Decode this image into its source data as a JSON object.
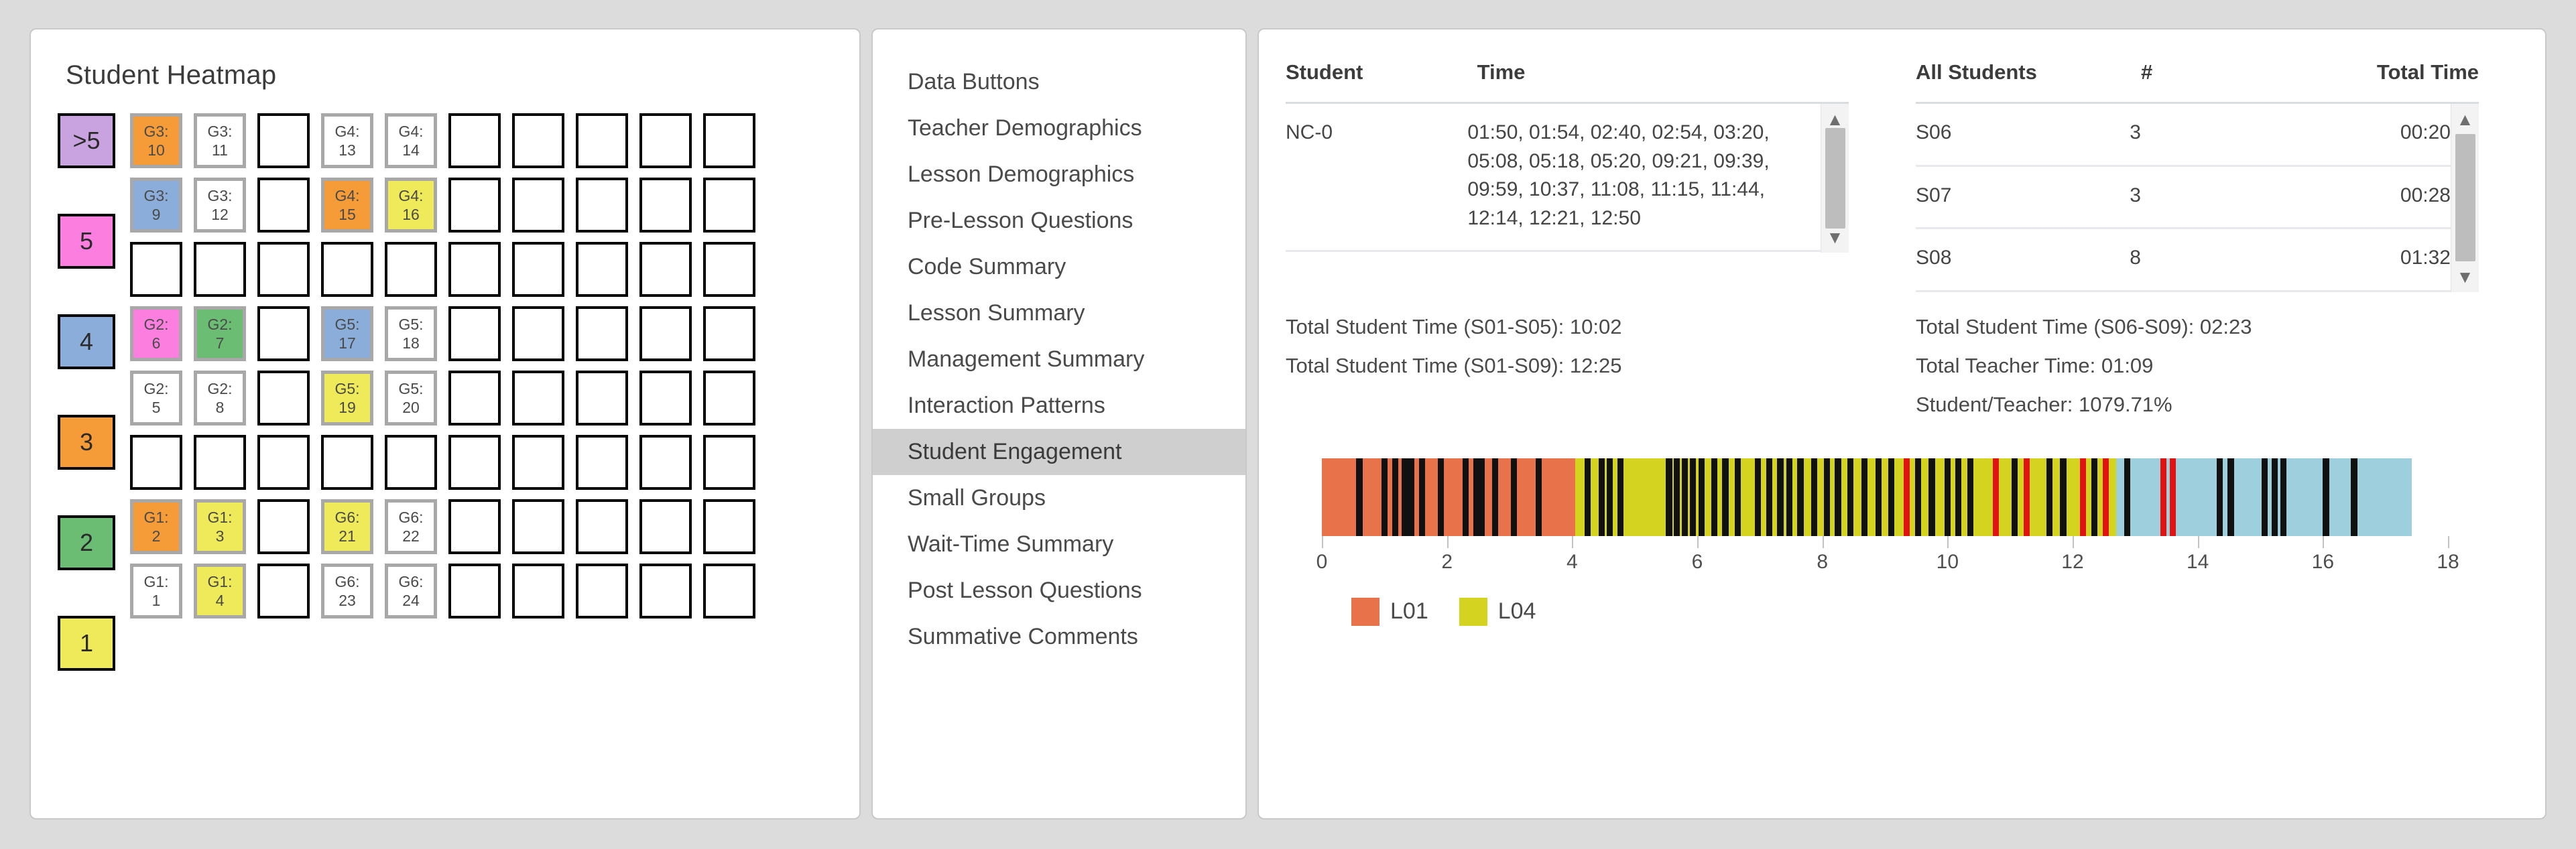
{
  "heatmap": {
    "title": "Student Heatmap",
    "legend": [
      {
        "label": ">5",
        "color": "#c9a3e0"
      },
      {
        "label": "5",
        "color": "#fc7fe0"
      },
      {
        "label": "4",
        "color": "#8badd9"
      },
      {
        "label": "3",
        "color": "#f59b38"
      },
      {
        "label": "2",
        "color": "#6cbd74"
      },
      {
        "label": "1",
        "color": "#eeea5a"
      }
    ],
    "columns": 10,
    "rows": [
      {
        "legend": ">5",
        "cells": [
          {
            "top": "G3:",
            "bottom": "10",
            "color": "#f59b38",
            "filled": true
          },
          {
            "top": "G3:",
            "bottom": "11",
            "color": "#ffffff",
            "filled": true
          },
          {
            "top": "",
            "bottom": "",
            "color": "#ffffff",
            "filled": false
          },
          {
            "top": "G4:",
            "bottom": "13",
            "color": "#ffffff",
            "filled": true
          },
          {
            "top": "G4:",
            "bottom": "14",
            "color": "#ffffff",
            "filled": true
          },
          {
            "top": "",
            "bottom": "",
            "color": "#ffffff",
            "filled": false
          },
          {
            "top": "",
            "bottom": "",
            "color": "#ffffff",
            "filled": false
          },
          {
            "top": "",
            "bottom": "",
            "color": "#ffffff",
            "filled": false
          },
          {
            "top": "",
            "bottom": "",
            "color": "#ffffff",
            "filled": false
          },
          {
            "top": "",
            "bottom": "",
            "color": "#ffffff",
            "filled": false
          }
        ]
      },
      {
        "legend": "5",
        "cells": [
          {
            "top": "G3:",
            "bottom": "9",
            "color": "#8badd9",
            "filled": true
          },
          {
            "top": "G3:",
            "bottom": "12",
            "color": "#ffffff",
            "filled": true
          },
          {
            "top": "",
            "bottom": "",
            "color": "#ffffff",
            "filled": false
          },
          {
            "top": "G4:",
            "bottom": "15",
            "color": "#f59b38",
            "filled": true
          },
          {
            "top": "G4:",
            "bottom": "16",
            "color": "#eeea5a",
            "filled": true
          },
          {
            "top": "",
            "bottom": "",
            "color": "#ffffff",
            "filled": false
          },
          {
            "top": "",
            "bottom": "",
            "color": "#ffffff",
            "filled": false
          },
          {
            "top": "",
            "bottom": "",
            "color": "#ffffff",
            "filled": false
          },
          {
            "top": "",
            "bottom": "",
            "color": "#ffffff",
            "filled": false
          },
          {
            "top": "",
            "bottom": "",
            "color": "#ffffff",
            "filled": false
          }
        ]
      },
      {
        "legend": "",
        "cells": [
          {
            "top": "",
            "bottom": "",
            "color": "#ffffff",
            "filled": false
          },
          {
            "top": "",
            "bottom": "",
            "color": "#ffffff",
            "filled": false
          },
          {
            "top": "",
            "bottom": "",
            "color": "#ffffff",
            "filled": false
          },
          {
            "top": "",
            "bottom": "",
            "color": "#ffffff",
            "filled": false
          },
          {
            "top": "",
            "bottom": "",
            "color": "#ffffff",
            "filled": false
          },
          {
            "top": "",
            "bottom": "",
            "color": "#ffffff",
            "filled": false
          },
          {
            "top": "",
            "bottom": "",
            "color": "#ffffff",
            "filled": false
          },
          {
            "top": "",
            "bottom": "",
            "color": "#ffffff",
            "filled": false
          },
          {
            "top": "",
            "bottom": "",
            "color": "#ffffff",
            "filled": false
          },
          {
            "top": "",
            "bottom": "",
            "color": "#ffffff",
            "filled": false
          }
        ]
      },
      {
        "legend": "4",
        "cells": [
          {
            "top": "G2:",
            "bottom": "6",
            "color": "#fc7fe0",
            "filled": true
          },
          {
            "top": "G2:",
            "bottom": "7",
            "color": "#6cbd74",
            "filled": true
          },
          {
            "top": "",
            "bottom": "",
            "color": "#ffffff",
            "filled": false
          },
          {
            "top": "G5:",
            "bottom": "17",
            "color": "#8badd9",
            "filled": true
          },
          {
            "top": "G5:",
            "bottom": "18",
            "color": "#ffffff",
            "filled": true
          },
          {
            "top": "",
            "bottom": "",
            "color": "#ffffff",
            "filled": false
          },
          {
            "top": "",
            "bottom": "",
            "color": "#ffffff",
            "filled": false
          },
          {
            "top": "",
            "bottom": "",
            "color": "#ffffff",
            "filled": false
          },
          {
            "top": "",
            "bottom": "",
            "color": "#ffffff",
            "filled": false
          },
          {
            "top": "",
            "bottom": "",
            "color": "#ffffff",
            "filled": false
          }
        ]
      },
      {
        "legend": "3",
        "cells": [
          {
            "top": "G2:",
            "bottom": "5",
            "color": "#ffffff",
            "filled": true
          },
          {
            "top": "G2:",
            "bottom": "8",
            "color": "#ffffff",
            "filled": true
          },
          {
            "top": "",
            "bottom": "",
            "color": "#ffffff",
            "filled": false
          },
          {
            "top": "G5:",
            "bottom": "19",
            "color": "#eeea5a",
            "filled": true
          },
          {
            "top": "G5:",
            "bottom": "20",
            "color": "#ffffff",
            "filled": true
          },
          {
            "top": "",
            "bottom": "",
            "color": "#ffffff",
            "filled": false
          },
          {
            "top": "",
            "bottom": "",
            "color": "#ffffff",
            "filled": false
          },
          {
            "top": "",
            "bottom": "",
            "color": "#ffffff",
            "filled": false
          },
          {
            "top": "",
            "bottom": "",
            "color": "#ffffff",
            "filled": false
          },
          {
            "top": "",
            "bottom": "",
            "color": "#ffffff",
            "filled": false
          }
        ]
      },
      {
        "legend": "2",
        "cells": [
          {
            "top": "",
            "bottom": "",
            "color": "#ffffff",
            "filled": false
          },
          {
            "top": "",
            "bottom": "",
            "color": "#ffffff",
            "filled": false
          },
          {
            "top": "",
            "bottom": "",
            "color": "#ffffff",
            "filled": false
          },
          {
            "top": "",
            "bottom": "",
            "color": "#ffffff",
            "filled": false
          },
          {
            "top": "",
            "bottom": "",
            "color": "#ffffff",
            "filled": false
          },
          {
            "top": "",
            "bottom": "",
            "color": "#ffffff",
            "filled": false
          },
          {
            "top": "",
            "bottom": "",
            "color": "#ffffff",
            "filled": false
          },
          {
            "top": "",
            "bottom": "",
            "color": "#ffffff",
            "filled": false
          },
          {
            "top": "",
            "bottom": "",
            "color": "#ffffff",
            "filled": false
          },
          {
            "top": "",
            "bottom": "",
            "color": "#ffffff",
            "filled": false
          }
        ]
      },
      {
        "legend": "1",
        "cells": [
          {
            "top": "G1:",
            "bottom": "2",
            "color": "#f59b38",
            "filled": true
          },
          {
            "top": "G1:",
            "bottom": "3",
            "color": "#eeea5a",
            "filled": true
          },
          {
            "top": "",
            "bottom": "",
            "color": "#ffffff",
            "filled": false
          },
          {
            "top": "G6:",
            "bottom": "21",
            "color": "#eeea5a",
            "filled": true
          },
          {
            "top": "G6:",
            "bottom": "22",
            "color": "#ffffff",
            "filled": true
          },
          {
            "top": "",
            "bottom": "",
            "color": "#ffffff",
            "filled": false
          },
          {
            "top": "",
            "bottom": "",
            "color": "#ffffff",
            "filled": false
          },
          {
            "top": "",
            "bottom": "",
            "color": "#ffffff",
            "filled": false
          },
          {
            "top": "",
            "bottom": "",
            "color": "#ffffff",
            "filled": false
          },
          {
            "top": "",
            "bottom": "",
            "color": "#ffffff",
            "filled": false
          }
        ]
      },
      {
        "legend": "",
        "cells": [
          {
            "top": "G1:",
            "bottom": "1",
            "color": "#ffffff",
            "filled": true
          },
          {
            "top": "G1:",
            "bottom": "4",
            "color": "#eeea5a",
            "filled": true
          },
          {
            "top": "",
            "bottom": "",
            "color": "#ffffff",
            "filled": false
          },
          {
            "top": "G6:",
            "bottom": "23",
            "color": "#ffffff",
            "filled": true
          },
          {
            "top": "G6:",
            "bottom": "24",
            "color": "#ffffff",
            "filled": true
          },
          {
            "top": "",
            "bottom": "",
            "color": "#ffffff",
            "filled": false
          },
          {
            "top": "",
            "bottom": "",
            "color": "#ffffff",
            "filled": false
          },
          {
            "top": "",
            "bottom": "",
            "color": "#ffffff",
            "filled": false
          },
          {
            "top": "",
            "bottom": "",
            "color": "#ffffff",
            "filled": false
          },
          {
            "top": "",
            "bottom": "",
            "color": "#ffffff",
            "filled": false
          }
        ]
      }
    ]
  },
  "menu": {
    "items": [
      {
        "label": "Data Buttons",
        "active": false
      },
      {
        "label": "Teacher Demographics",
        "active": false
      },
      {
        "label": "Lesson Demographics",
        "active": false
      },
      {
        "label": "Pre-Lesson Questions",
        "active": false
      },
      {
        "label": "Code Summary",
        "active": false
      },
      {
        "label": "Lesson Summary",
        "active": false
      },
      {
        "label": "Management Summary",
        "active": false
      },
      {
        "label": "Interaction Patterns",
        "active": false
      },
      {
        "label": "Student Engagement",
        "active": true
      },
      {
        "label": "Small Groups",
        "active": false
      },
      {
        "label": "Wait-Time Summary",
        "active": false
      },
      {
        "label": "Post Lesson Questions",
        "active": false
      },
      {
        "label": "Summative Comments",
        "active": false
      }
    ]
  },
  "student_time_table": {
    "headers": {
      "student": "Student",
      "time": "Time"
    },
    "rows": [
      {
        "student": "NC-0",
        "time": "01:50, 01:54, 02:40, 02:54, 03:20, 05:08, 05:18, 05:20, 09:21, 09:39, 09:59, 10:37, 11:08, 11:15, 11:44, 12:14, 12:21, 12:50"
      }
    ]
  },
  "all_students_table": {
    "headers": {
      "student": "All Students",
      "count": "#",
      "total": "Total Time"
    },
    "rows": [
      {
        "student": "S06",
        "count": "3",
        "total": "00:20"
      },
      {
        "student": "S07",
        "count": "3",
        "total": "00:28"
      },
      {
        "student": "S08",
        "count": "8",
        "total": "01:32"
      }
    ]
  },
  "summary_left": [
    "Total Student Time (S01-S05): 10:02",
    "Total Student Time (S01-S09): 12:25"
  ],
  "summary_right": [
    "Total Student Time (S06-S09): 02:23",
    "Total Teacher Time: 01:09",
    "Student/Teacher: 1079.71%"
  ],
  "chart_data": {
    "type": "bar",
    "title": "",
    "xlabel": "",
    "ylabel": "",
    "xlim": [
      0,
      18
    ],
    "grid": false,
    "legend_position": "bottom-left",
    "tick_labels": [
      "0",
      "2",
      "4",
      "6",
      "8",
      "10",
      "12",
      "14",
      "16",
      "18"
    ],
    "ticks": [
      0,
      2,
      4,
      6,
      8,
      10,
      12,
      14,
      16,
      18
    ],
    "legend": [
      {
        "name": "L01",
        "color": "#e8734a"
      },
      {
        "name": "L04",
        "color": "#d4d420"
      }
    ],
    "background_segments": [
      {
        "label": "L01",
        "start": 0.0,
        "end": 4.05,
        "color": "#e8734a"
      },
      {
        "label": "L04",
        "start": 4.05,
        "end": 12.7,
        "color": "#d4d420"
      },
      {
        "label": "",
        "start": 12.7,
        "end": 17.42,
        "color": "#9dd0dc"
      }
    ],
    "event_marks": [
      {
        "x": 0.55,
        "color": "#111111"
      },
      {
        "x": 0.95,
        "color": "#111111"
      },
      {
        "x": 1.12,
        "color": "#111111"
      },
      {
        "x": 1.28,
        "color": "#111111"
      },
      {
        "x": 1.38,
        "color": "#111111"
      },
      {
        "x": 1.55,
        "color": "#111111"
      },
      {
        "x": 1.85,
        "color": "#111111"
      },
      {
        "x": 2.25,
        "color": "#111111"
      },
      {
        "x": 2.42,
        "color": "#111111"
      },
      {
        "x": 2.5,
        "color": "#111111"
      },
      {
        "x": 2.72,
        "color": "#111111"
      },
      {
        "x": 3.02,
        "color": "#111111"
      },
      {
        "x": 3.42,
        "color": "#111111"
      },
      {
        "x": 4.2,
        "color": "#111111"
      },
      {
        "x": 4.42,
        "color": "#111111"
      },
      {
        "x": 4.55,
        "color": "#111111"
      },
      {
        "x": 4.72,
        "color": "#111111"
      },
      {
        "x": 5.5,
        "color": "#111111"
      },
      {
        "x": 5.62,
        "color": "#111111"
      },
      {
        "x": 5.75,
        "color": "#111111"
      },
      {
        "x": 5.88,
        "color": "#111111"
      },
      {
        "x": 6.02,
        "color": "#111111"
      },
      {
        "x": 6.22,
        "color": "#111111"
      },
      {
        "x": 6.4,
        "color": "#111111"
      },
      {
        "x": 6.6,
        "color": "#111111"
      },
      {
        "x": 6.92,
        "color": "#111111"
      },
      {
        "x": 7.1,
        "color": "#111111"
      },
      {
        "x": 7.28,
        "color": "#111111"
      },
      {
        "x": 7.42,
        "color": "#111111"
      },
      {
        "x": 7.6,
        "color": "#111111"
      },
      {
        "x": 7.82,
        "color": "#111111"
      },
      {
        "x": 8.02,
        "color": "#111111"
      },
      {
        "x": 8.2,
        "color": "#111111"
      },
      {
        "x": 8.4,
        "color": "#111111"
      },
      {
        "x": 8.62,
        "color": "#111111"
      },
      {
        "x": 8.85,
        "color": "#111111"
      },
      {
        "x": 9.05,
        "color": "#111111"
      },
      {
        "x": 9.3,
        "color": "#e11212"
      },
      {
        "x": 9.48,
        "color": "#111111"
      },
      {
        "x": 9.7,
        "color": "#111111"
      },
      {
        "x": 9.95,
        "color": "#111111"
      },
      {
        "x": 10.12,
        "color": "#111111"
      },
      {
        "x": 10.32,
        "color": "#111111"
      },
      {
        "x": 10.72,
        "color": "#e11212"
      },
      {
        "x": 11.02,
        "color": "#111111"
      },
      {
        "x": 11.22,
        "color": "#e11212"
      },
      {
        "x": 11.58,
        "color": "#111111"
      },
      {
        "x": 11.8,
        "color": "#111111"
      },
      {
        "x": 12.12,
        "color": "#e11212"
      },
      {
        "x": 12.3,
        "color": "#111111"
      },
      {
        "x": 12.48,
        "color": "#e11212"
      },
      {
        "x": 12.82,
        "color": "#111111"
      },
      {
        "x": 13.4,
        "color": "#e11212"
      },
      {
        "x": 13.55,
        "color": "#e11212"
      },
      {
        "x": 14.3,
        "color": "#111111"
      },
      {
        "x": 14.48,
        "color": "#111111"
      },
      {
        "x": 15.02,
        "color": "#111111"
      },
      {
        "x": 15.18,
        "color": "#111111"
      },
      {
        "x": 15.32,
        "color": "#111111"
      },
      {
        "x": 16.0,
        "color": "#111111"
      },
      {
        "x": 16.45,
        "color": "#111111"
      }
    ]
  }
}
